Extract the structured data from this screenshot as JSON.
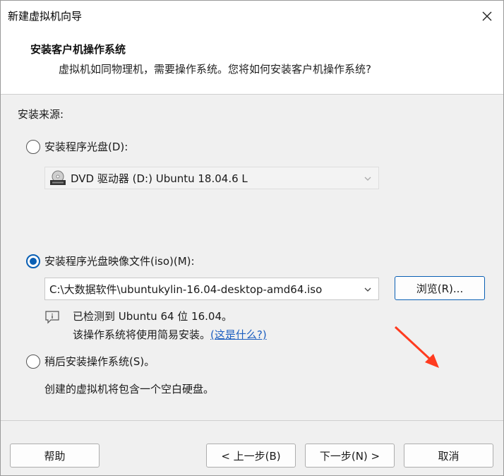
{
  "window": {
    "title": "新建虚拟机向导"
  },
  "header": {
    "title": "安装客户机操作系统",
    "subtitle": "虚拟机如同物理机，需要操作系统。您将如何安装客户机操作系统?"
  },
  "install_source": {
    "label": "安装来源:",
    "disc_option": {
      "label": "安装程序光盘(D):",
      "selected": false,
      "drive_value": "DVD 驱动器 (D:) Ubuntu 18.04.6 L",
      "icon": "dvd-rom-icon"
    },
    "iso_option": {
      "label": "安装程序光盘映像文件(iso)(M):",
      "selected": true,
      "path_value": "C:\\大数据软件\\ubuntukylin-16.04-desktop-amd64.iso",
      "browse_label": "浏览(R)..."
    },
    "detection": {
      "line1": "已检测到 Ubuntu 64 位 16.04。",
      "line2_prefix": "该操作系统将使用简易安装。",
      "link": "(这是什么?)"
    },
    "later_option": {
      "label": "稍后安装操作系统(S)。",
      "selected": false,
      "description": "创建的虚拟机将包含一个空白硬盘。"
    }
  },
  "footer": {
    "help": "帮助",
    "back": "< 上一步(B)",
    "next": "下一步(N) >",
    "cancel": "取消"
  },
  "colors": {
    "accent": "#0a5fb4",
    "annotation_arrow": "#ff3b1f",
    "link": "#1d5fc0"
  }
}
